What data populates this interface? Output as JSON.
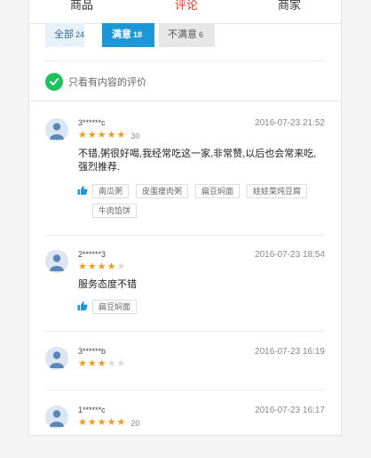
{
  "tabs": [
    {
      "label": "商品"
    },
    {
      "label": "评论"
    },
    {
      "label": "商家"
    }
  ],
  "active_tab_color": "#e8351f",
  "filters": {
    "all": {
      "label": "全部",
      "count": "24"
    },
    "good": {
      "label": "满意",
      "count": "18"
    },
    "bad": {
      "label": "不满意",
      "count": "6"
    }
  },
  "only_content_label": "只看有内容的评价",
  "reviews": [
    {
      "user": "3******c",
      "date": "2016-07-23 21:52",
      "stars": 5,
      "score": "30",
      "text": "不错,粥很好喝,我经常吃这一家,非常赞,以后也会常来吃,强烈推荐.",
      "tags": [
        "南瓜粥",
        "皮蛋瘦肉粥",
        "扁豆焖面",
        "娃娃菜炖豆腐",
        "牛肉馅饼"
      ]
    },
    {
      "user": "2******3",
      "date": "2016-07-23 18:54",
      "stars": 4,
      "score": "",
      "text": "服务态度不错",
      "tags": [
        "扁豆焖面"
      ]
    },
    {
      "user": "3******b",
      "date": "2016-07-23 16:19",
      "stars": 3,
      "score": "",
      "text": "",
      "tags": []
    },
    {
      "user": "1******c",
      "date": "2016-07-23 16:17",
      "stars": 5,
      "score": "20",
      "text": "",
      "tags": []
    }
  ],
  "icons": {
    "check": "check-circle-icon",
    "thumb": "thumbs-up-icon",
    "star": "star-icon",
    "avatar": "user-avatar-icon"
  },
  "colors": {
    "star_on": "#f39a1b",
    "star_off": "#d9d9d9",
    "filter_active": "#1c97d8",
    "check": "#1ec25c"
  }
}
